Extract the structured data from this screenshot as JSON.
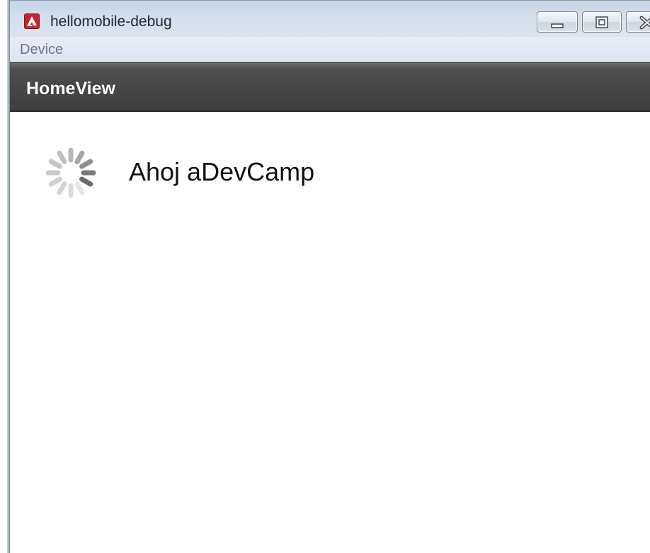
{
  "window": {
    "title": "hellomobile-debug",
    "app_icon": "adobe-air-icon",
    "controls": {
      "minimize_icon": "minimize-icon",
      "maximize_icon": "maximize-icon",
      "close_icon": "close-icon"
    }
  },
  "menubar": {
    "items": [
      {
        "label": "Device"
      }
    ]
  },
  "appbar": {
    "title": "HomeView"
  },
  "content": {
    "spinner_icon": "busy-spinner-icon",
    "greeting": "Ahoj aDevCamp"
  },
  "colors": {
    "titlebar": "#d4dfeb",
    "appbar": "#454545",
    "app_icon_red": "#c8232c",
    "menu_text": "#6f7780"
  }
}
